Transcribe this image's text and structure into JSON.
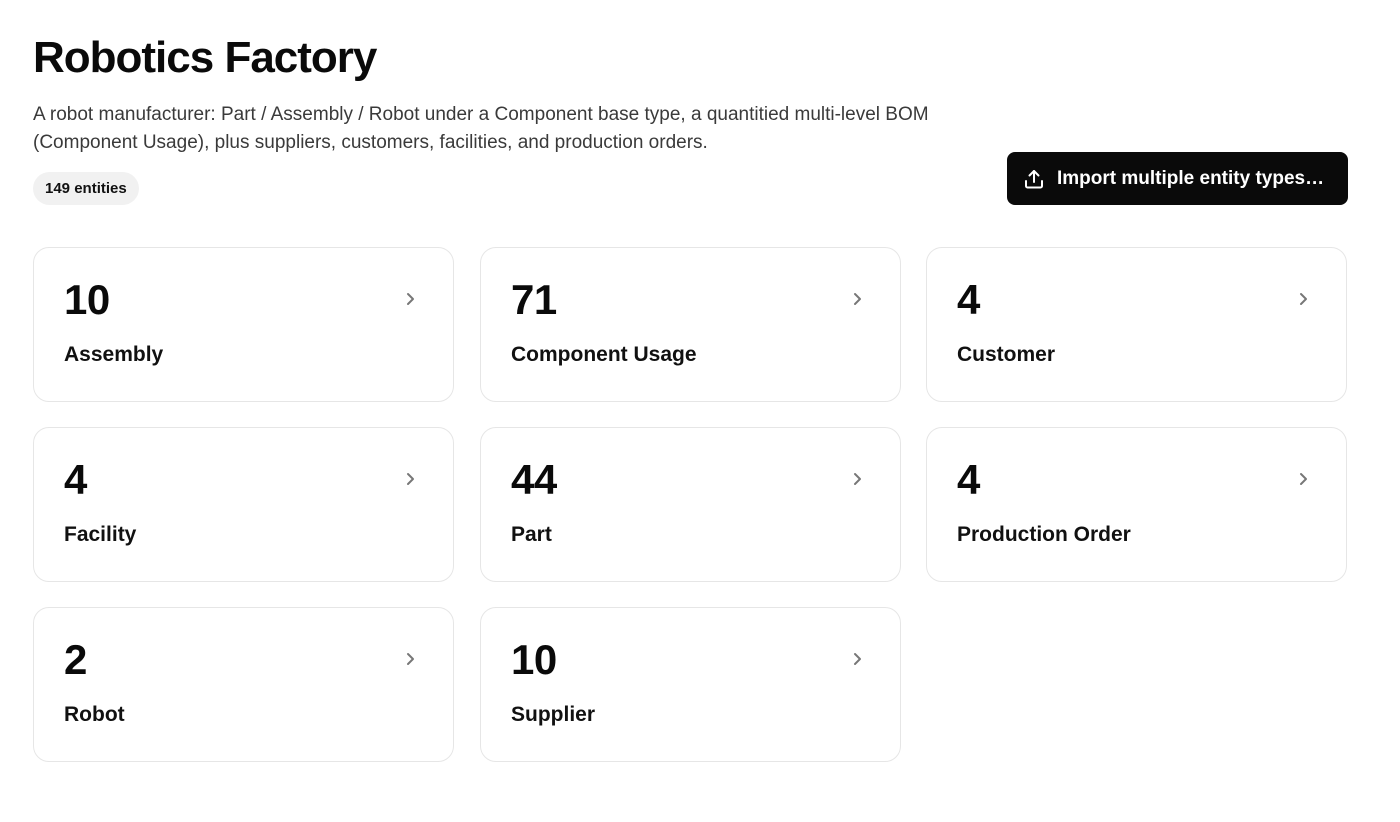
{
  "header": {
    "title": "Robotics Factory",
    "description": "A robot manufacturer: Part / Assembly / Robot under a Component base type, a quantitied multi-level BOM (Component Usage), plus suppliers, customers, facilities, and production orders.",
    "entity_count": "149 entities",
    "import_label": "Import multiple entity types…",
    "import_icon": "upload-icon"
  },
  "cards": [
    {
      "count": "10",
      "label": "Assembly"
    },
    {
      "count": "71",
      "label": "Component Usage"
    },
    {
      "count": "4",
      "label": "Customer"
    },
    {
      "count": "4",
      "label": "Facility"
    },
    {
      "count": "44",
      "label": "Part"
    },
    {
      "count": "4",
      "label": "Production Order"
    },
    {
      "count": "2",
      "label": "Robot"
    },
    {
      "count": "10",
      "label": "Supplier"
    }
  ],
  "card_icon": "chevron-right-icon",
  "colors": {
    "text": "#0a0a0a",
    "muted_text": "#3a3a3a",
    "badge_bg": "#f1f1f1",
    "button_bg": "#0a0a0a",
    "card_border": "#e6e6e6",
    "chevron": "#777777"
  }
}
